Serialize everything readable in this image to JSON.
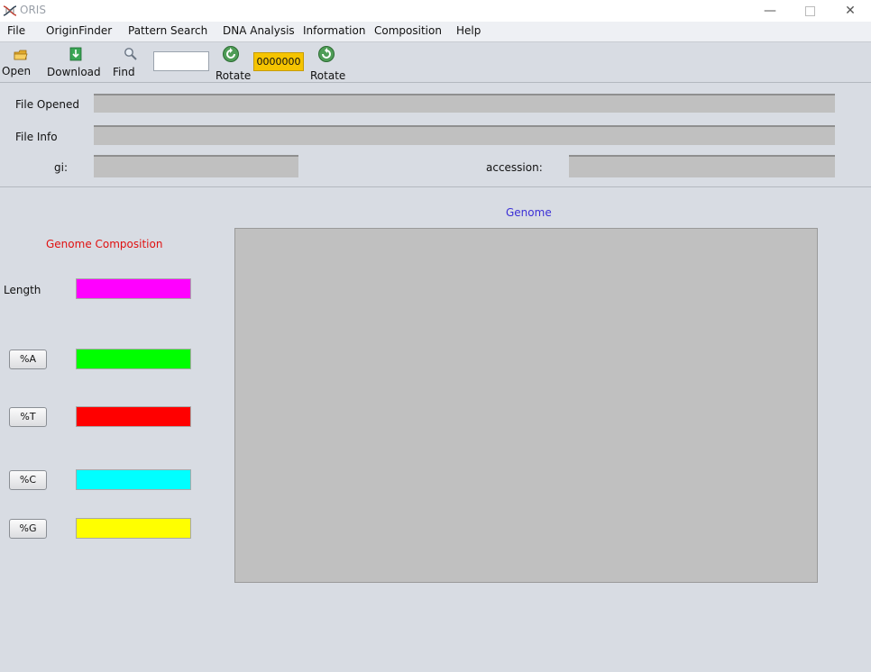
{
  "window": {
    "title": "ORIS"
  },
  "menu": {
    "items": [
      "File",
      "OriginFinder",
      "Pattern Search",
      "DNA Analysis",
      "Information",
      "Composition",
      "Help"
    ]
  },
  "toolbar": {
    "open_label": "Open",
    "download_label": "Download",
    "find_label": "Find",
    "find_value": "",
    "rotate_left_label": "Rotate",
    "counter_value": "0000000",
    "rotate_right_label": "Rotate"
  },
  "info": {
    "file_opened_label": "File Opened",
    "file_info_label": "File Info",
    "gi_label": "gi:",
    "accession_label": "accession:"
  },
  "composition": {
    "title": "Genome Composition",
    "length_label": "Length",
    "buttons": [
      "%A",
      "%T",
      "%C",
      "%G"
    ],
    "colors": {
      "length": "#ff00ff",
      "a": "#00ff00",
      "t": "#ff0000",
      "c": "#00ffff",
      "g": "#ffff00"
    }
  },
  "genome": {
    "title": "Genome"
  }
}
